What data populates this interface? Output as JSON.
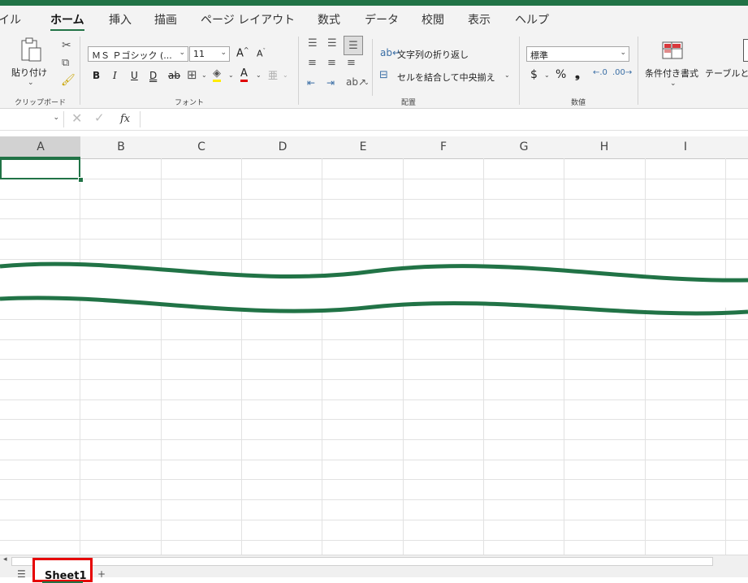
{
  "menu": {
    "tabs": [
      {
        "label": "イル"
      },
      {
        "label": "ホーム"
      },
      {
        "label": "挿入"
      },
      {
        "label": "描画"
      },
      {
        "label": "ページ レイアウト"
      },
      {
        "label": "数式"
      },
      {
        "label": "データ"
      },
      {
        "label": "校閲"
      },
      {
        "label": "表示"
      },
      {
        "label": "ヘルプ"
      }
    ]
  },
  "ribbon": {
    "clipboard": {
      "paste_label": "貼り付け",
      "group_label": "クリップボード"
    },
    "font": {
      "font_name": "ＭＳ Ｐゴシック (...",
      "font_size": "11",
      "group_label": "フォント"
    },
    "alignment": {
      "wrap_label": "文字列の折り返し",
      "merge_label": "セルを結合して中央揃え",
      "group_label": "配置"
    },
    "number": {
      "format": "標準",
      "currency": "$",
      "percent": "%",
      "comma": "❟",
      "group_label": "数値"
    },
    "styles": {
      "conditional_label": "条件付き書式",
      "table_label": "テーブルと"
    }
  },
  "formula_bar": {
    "fx": "fx"
  },
  "columns": [
    "A",
    "B",
    "C",
    "D",
    "E",
    "F",
    "G",
    "H",
    "I"
  ],
  "sheets": [
    {
      "name": "Sheet1"
    }
  ],
  "colors": {
    "accent": "#217346",
    "highlight": "#e60000"
  }
}
